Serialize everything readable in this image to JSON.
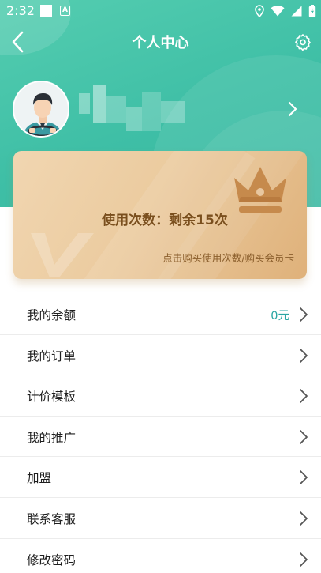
{
  "status_bar": {
    "time": "2:32",
    "a_badge": "A",
    "icons": [
      "square-notification-icon",
      "a-notification-icon",
      "location-icon",
      "wifi-icon",
      "signal-icon",
      "battery-icon"
    ]
  },
  "header": {
    "title": "个人中心",
    "back_icon": "chevron-left-icon",
    "settings_icon": "gear-icon",
    "accent_color": "#3fbfa6"
  },
  "profile": {
    "avatar_icon": "driver-avatar",
    "name_blurred": true,
    "chevron_icon": "chevron-right-icon"
  },
  "vip_card": {
    "usage_text": "使用次数：剩余15次",
    "buy_text": "点击购买使用次数/购买会员卡",
    "crown_icon": "crown-icon",
    "colors": {
      "text": "#7a4f1e",
      "crown": "#c8894a"
    }
  },
  "menu": [
    {
      "label": "我的余额",
      "value": "0元"
    },
    {
      "label": "我的订单",
      "value": ""
    },
    {
      "label": "计价模板",
      "value": ""
    },
    {
      "label": "我的推广",
      "value": ""
    },
    {
      "label": "加盟",
      "value": ""
    },
    {
      "label": "联系客服",
      "value": ""
    },
    {
      "label": "修改密码",
      "value": ""
    }
  ]
}
